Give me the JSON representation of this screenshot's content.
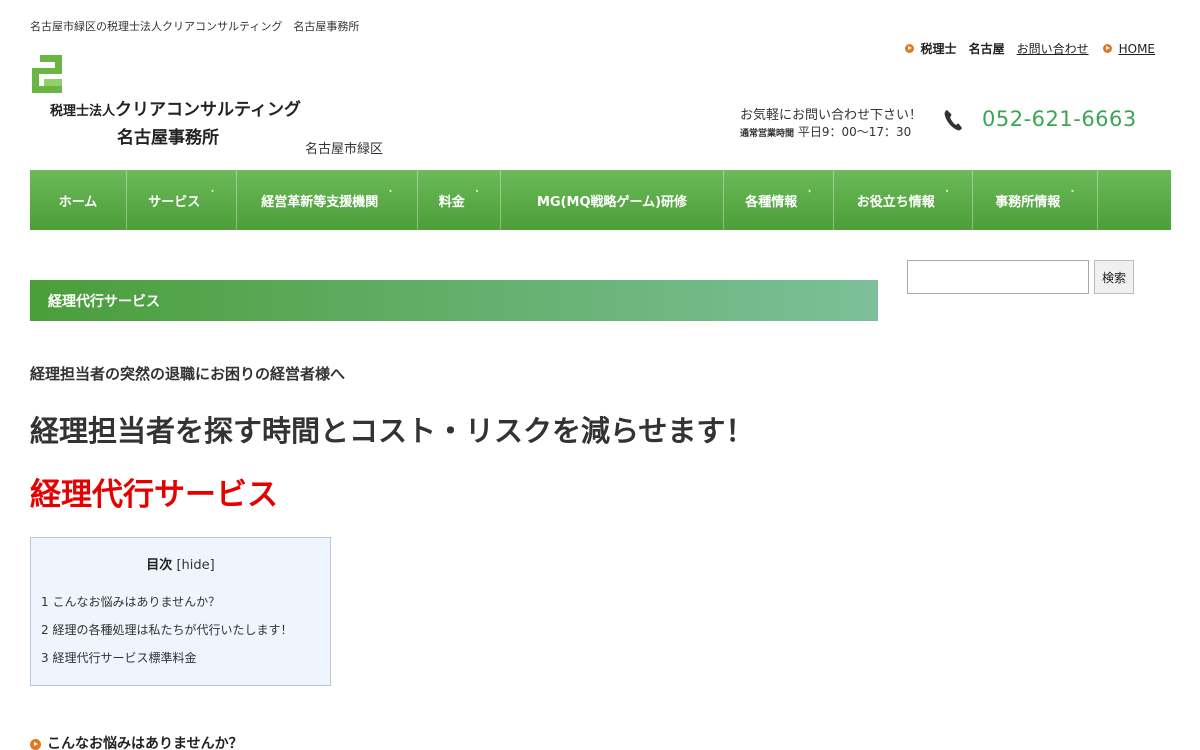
{
  "header": {
    "tagline": "名古屋市緑区の税理士法人クリアコンサルティング　名古屋事務所",
    "toplinks": {
      "item1_a": "税理士",
      "item1_b": "名古屋",
      "contact_link": "お問い合わせ",
      "home_link": "HOME"
    },
    "logo": {
      "line1_prefix": "税理士法人",
      "line1_main": "クリアコンサルティング",
      "line2": "名古屋事務所"
    },
    "area": "名古屋市緑区",
    "contact": {
      "line1": "お気軽にお問い合わせ下さい！",
      "hours_label": "通常営業時間",
      "hours": "平日9：00〜17：30",
      "phone": "052-621-6663"
    },
    "colors": {
      "brand_green": "#4b9e38",
      "phone_green": "#3aa655",
      "accent_orange": "#e07820"
    }
  },
  "nav": {
    "items": [
      {
        "label": "ホーム",
        "caret": ""
      },
      {
        "label": "サービス",
        "caret": "˃"
      },
      {
        "label": "経営革新等支援機関",
        "caret": "˃"
      },
      {
        "label": "料金",
        "caret": "˃"
      },
      {
        "label": "MG(MQ戦略ゲーム)研修",
        "caret": ""
      },
      {
        "label": "各種情報",
        "caret": "˃"
      },
      {
        "label": "お役立ち情報",
        "caret": "˃"
      },
      {
        "label": "事務所情報",
        "caret": "˃"
      }
    ]
  },
  "search": {
    "value": "",
    "button_label": "検索"
  },
  "main": {
    "page_title": "経理代行サービス",
    "lead": "経理担当者の突然の退職にお困りの経営者様へ",
    "headline": "経理担当者を探す時間とコスト・リスクを減らせます！",
    "red_title": "経理代行サービス",
    "toc": {
      "title": "目次",
      "toggle": "[hide]",
      "items": [
        "1 こんなお悩みはありませんか？",
        "2 経理の各種処理は私たちが代行いたします！",
        "3 経理代行サービス標準料金"
      ]
    },
    "section1_heading": "こんなお悩みはありませんか？",
    "title_color": "#e60000"
  }
}
